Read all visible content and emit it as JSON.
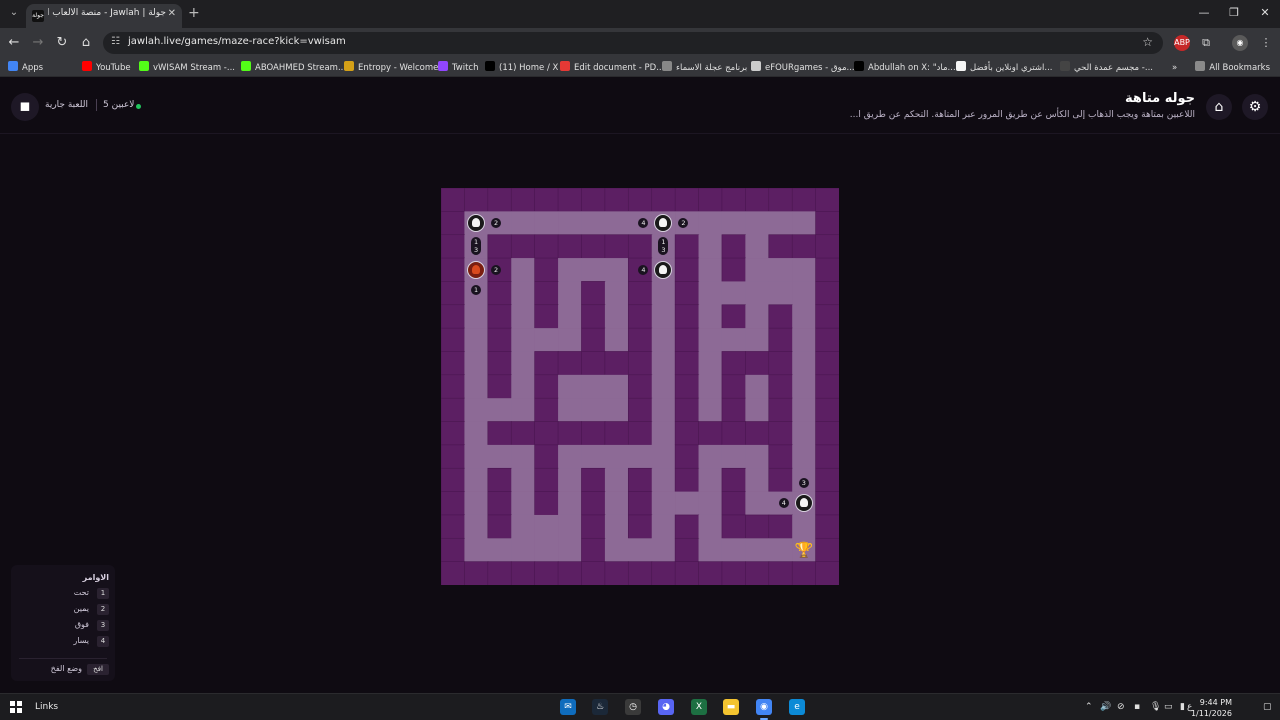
{
  "browser": {
    "tab_title": "جولة | Jawlah - منصة الألعاب الـ...",
    "tab_favicon": "جولة",
    "url": "jawlah.live/games/maze-race?kick=vwisam",
    "icons": {
      "back": "arrow-left-icon",
      "forward": "arrow-right-icon",
      "reload": "reload-icon",
      "home": "home-icon",
      "site_info": "tune-icon",
      "bookmark": "star-icon"
    },
    "bookmarks": [
      {
        "label": "Apps",
        "icon": "apps-grid-icon",
        "color": "#4285f4"
      },
      {
        "label": "YouTube",
        "icon": "youtube-icon",
        "color": "#ff0000"
      },
      {
        "label": "vWISAM Stream -...",
        "icon": "kick-icon",
        "color": "#53fc18"
      },
      {
        "label": "ABOAHMED Stream...",
        "icon": "kick-icon",
        "color": "#53fc18"
      },
      {
        "label": "Entropy - Welcome",
        "icon": "entropy-icon",
        "color": "#d4a017"
      },
      {
        "label": "Twitch",
        "icon": "twitch-icon",
        "color": "#9146ff"
      },
      {
        "label": "(11) Home / X",
        "icon": "x-icon",
        "color": "#000000"
      },
      {
        "label": "Edit document - PD...",
        "icon": "pdf-icon",
        "color": "#e53935"
      },
      {
        "label": "برنامج عجلة الاسماء",
        "icon": "wheel-icon",
        "color": "#888888"
      },
      {
        "label": "eFOURgames - موق...",
        "icon": "efour-icon",
        "color": "#cccccc"
      },
      {
        "label": "Abdullah on X: \"ماد...",
        "icon": "x-icon",
        "color": "#000000"
      },
      {
        "label": "اشتري اونلاين بأفضل...",
        "icon": "amazon-icon",
        "color": "#f5f5f5"
      },
      {
        "label": "مجسم عمدة الحي -...",
        "icon": "shop-icon",
        "color": "#444444"
      }
    ],
    "all_bookmarks": "All Bookmarks"
  },
  "header": {
    "title": "جوله متاهة",
    "description": "اللاعبين بمتاهة ويجب الذهاب إلى الكأس عن طريق المرور عبر المتاهة. التحكم عن طريق ا...",
    "status": "اللعبة جارية",
    "players": "5 لاعبين",
    "logo": "chat-bubble-icon",
    "home_icon": "home-icon",
    "settings_icon": "gear-icon"
  },
  "maze": {
    "cols": 17,
    "rows": 17,
    "wall_color": "#5c1f63",
    "path_color": "#8d6a96",
    "grid": [
      "#################",
      "#...............#",
      "#.#######.#.#.###",
      "#.#.#...#.#.#...#",
      "#.#.#.#.#.#.....#",
      "#.#.#.#.#.#.#.#.#",
      "#.#...#.#.#...#.#",
      "#.#.#####.#.###.#",
      "#.#.#...#.#.#.#.#",
      "#...#...#.#.#.#.#",
      "#.#######.#####.#",
      "#...#.....#...#.#",
      "#.#.#.#.#.#.#.#.#",
      "#.#.#.#.#...#...#",
      "#.#...#.#.#.###.#",
      "#.....#...#.....#",
      "#################"
    ],
    "players": [
      {
        "name": "player-a",
        "cell": [
          1,
          1
        ],
        "style": "ghost",
        "badges": [
          {
            "text": "2",
            "side": "right"
          }
        ]
      },
      {
        "name": "player-b",
        "cell": [
          9,
          1
        ],
        "style": "ghost",
        "badges": [
          {
            "text": "4",
            "side": "left"
          },
          {
            "text": "2",
            "side": "right"
          }
        ]
      },
      {
        "name": "player-c",
        "cell": [
          1,
          3
        ],
        "style": "red",
        "badges": [
          {
            "text": "2",
            "side": "right"
          },
          {
            "text": "1",
            "side": "below"
          }
        ]
      },
      {
        "name": "player-d",
        "cell": [
          9,
          3
        ],
        "style": "ghost",
        "badges": [
          {
            "text": "4",
            "side": "left"
          }
        ]
      },
      {
        "name": "player-e",
        "cell": [
          15,
          13
        ],
        "style": "ghost",
        "badges": [
          {
            "text": "4",
            "side": "left"
          },
          {
            "text": "3",
            "side": "above"
          }
        ]
      }
    ],
    "stacked_badges": [
      {
        "cell": [
          1,
          2
        ],
        "lines": [
          "1",
          "3"
        ]
      },
      {
        "cell": [
          9,
          2
        ],
        "lines": [
          "1",
          "3"
        ]
      }
    ],
    "trophy_cell": [
      15,
      15
    ],
    "trophy_icon": "trophy-icon"
  },
  "commands": {
    "title": "الاوامر",
    "items": [
      {
        "key": "1",
        "label": "تحت"
      },
      {
        "key": "2",
        "label": "يمين"
      },
      {
        "key": "3",
        "label": "فوق"
      },
      {
        "key": "4",
        "label": "يسار"
      }
    ],
    "trap_key": "افخ",
    "trap_label": "وضع الفخ"
  },
  "taskbar": {
    "links": "Links",
    "apps": [
      {
        "name": "outlook-icon",
        "color": "#0f6cbd"
      },
      {
        "name": "steam-icon",
        "color": "#1b2838"
      },
      {
        "name": "clock-icon",
        "color": "#3a3a3a"
      },
      {
        "name": "discord-icon",
        "color": "#5865f2"
      },
      {
        "name": "excel-icon",
        "color": "#1d6f42"
      },
      {
        "name": "explorer-icon",
        "color": "#f4c430"
      },
      {
        "name": "chrome-icon",
        "color": "#4285f4"
      },
      {
        "name": "edge-icon",
        "color": "#0c8ad6"
      }
    ],
    "lang": "ع",
    "time": "9:44 PM",
    "date": "1/11/2026"
  }
}
